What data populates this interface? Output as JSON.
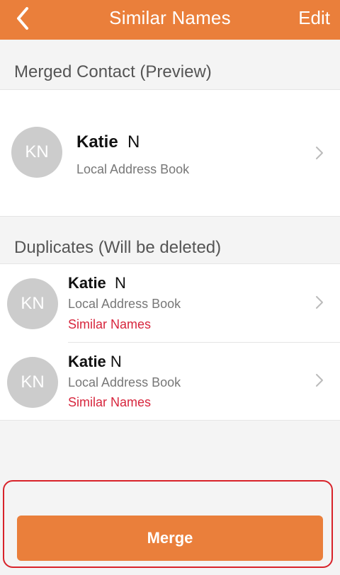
{
  "navbar": {
    "title": "Similar Names",
    "edit_label": "Edit",
    "back_icon": "chevron-left-icon"
  },
  "merged": {
    "header": "Merged Contact (Preview)",
    "contact": {
      "initials": "KN",
      "first_name": "Katie",
      "last_name": "N",
      "source": "Local Address Book"
    }
  },
  "duplicates": {
    "header": "Duplicates (Will be deleted)",
    "items": [
      {
        "initials": "KN",
        "first_name": "Katie",
        "last_name": "N",
        "source": "Local Address Book",
        "reason": "Similar Names"
      },
      {
        "initials": "KN",
        "first_name": "Katie",
        "last_name": "N",
        "source": "Local Address Book",
        "reason": "Similar Names"
      }
    ]
  },
  "merge_button_label": "Merge",
  "colors": {
    "accent": "#ea7f3b",
    "avatar_bg": "#cccccc",
    "reason_text": "#d7263d",
    "highlight_border": "#d8232a"
  }
}
